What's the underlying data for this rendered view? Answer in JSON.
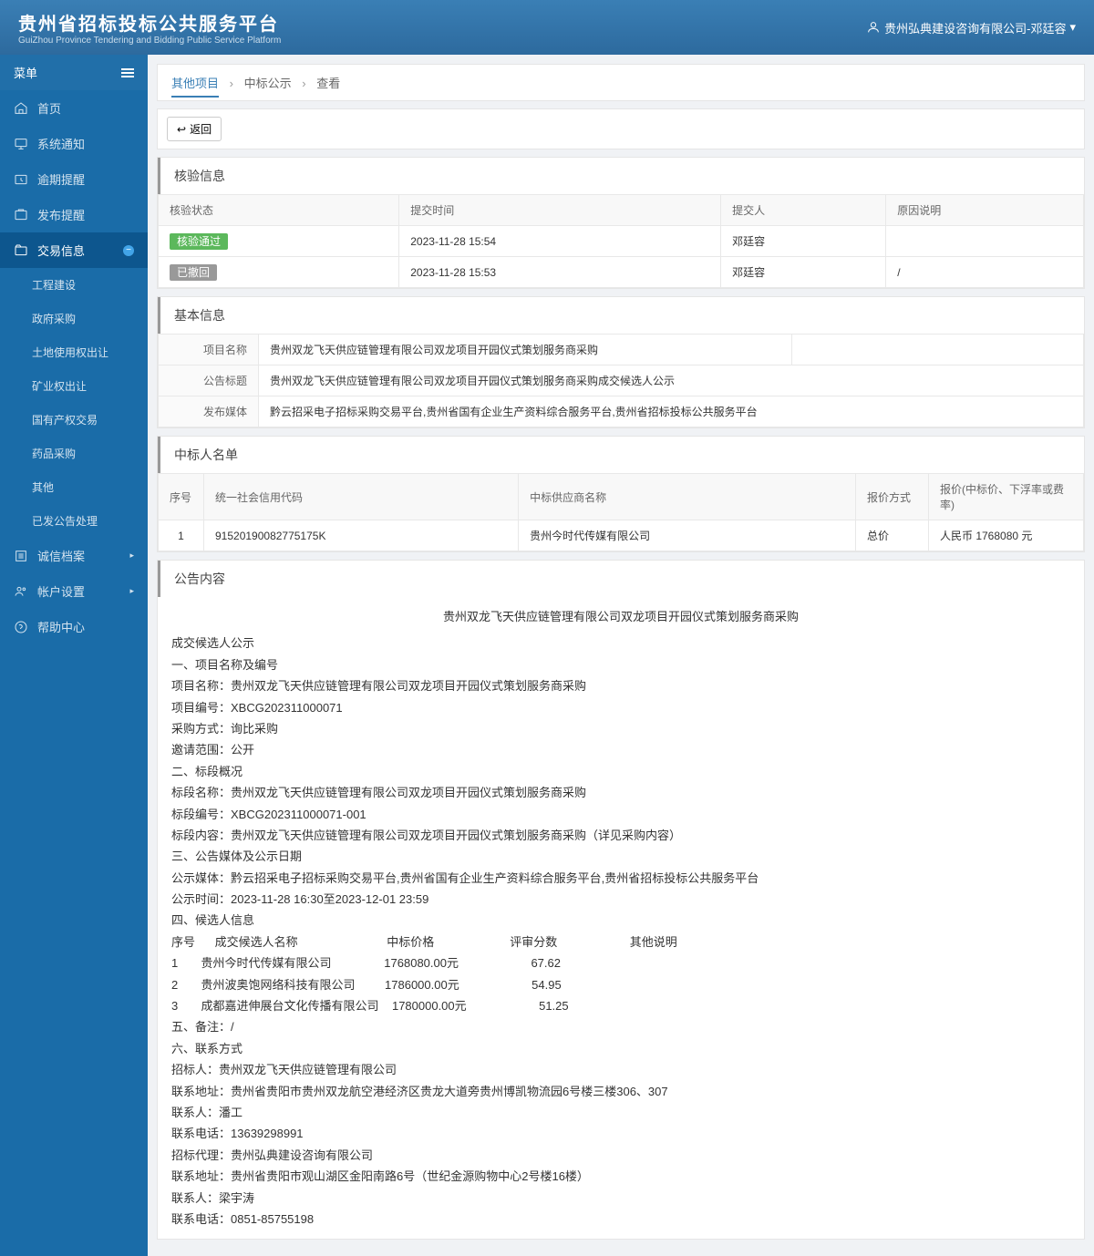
{
  "header": {
    "title": "贵州省招标投标公共服务平台",
    "subtitle": "GuiZhou Province Tendering and Bidding Public Service Platform",
    "user": "贵州弘典建设咨询有限公司-邓廷容"
  },
  "sidebar": {
    "menu_label": "菜单",
    "items": [
      {
        "label": "首页",
        "icon": "home"
      },
      {
        "label": "系统通知",
        "icon": "monitor"
      },
      {
        "label": "逾期提醒",
        "icon": "clock"
      },
      {
        "label": "发布提醒",
        "icon": "bell"
      },
      {
        "label": "交易信息",
        "icon": "folder",
        "active": true,
        "expand": true
      },
      {
        "label": "诚信档案",
        "icon": "list",
        "dot": true
      },
      {
        "label": "帐户设置",
        "icon": "user",
        "dot": true
      },
      {
        "label": "帮助中心",
        "icon": "help"
      }
    ],
    "subitems": [
      {
        "label": "工程建设"
      },
      {
        "label": "政府采购"
      },
      {
        "label": "土地使用权出让"
      },
      {
        "label": "矿业权出让"
      },
      {
        "label": "国有产权交易"
      },
      {
        "label": "药品采购"
      },
      {
        "label": "其他"
      },
      {
        "label": "已发公告处理"
      }
    ]
  },
  "breadcrumb": {
    "a": "其他项目",
    "b": "中标公示",
    "c": "查看"
  },
  "buttons": {
    "back": "返回"
  },
  "verify": {
    "title": "核验信息",
    "cols": {
      "status": "核验状态",
      "time": "提交时间",
      "person": "提交人",
      "reason": "原因说明"
    },
    "rows": [
      {
        "status": "核验通过",
        "badge": "green",
        "time": "2023-11-28 15:54",
        "person": "邓廷容",
        "reason": ""
      },
      {
        "status": "已撤回",
        "badge": "gray",
        "time": "2023-11-28 15:53",
        "person": "邓廷容",
        "reason": "/"
      }
    ]
  },
  "basic": {
    "title": "基本信息",
    "rows": {
      "project_name_label": "项目名称",
      "project_name": "贵州双龙飞天供应链管理有限公司双龙项目开园仪式策划服务商采购",
      "notice_title_label": "公告标题",
      "notice_title": "贵州双龙飞天供应链管理有限公司双龙项目开园仪式策划服务商采购成交候选人公示",
      "media_label": "发布媒体",
      "media": "黔云招采电子招标采购交易平台,贵州省国有企业生产资料综合服务平台,贵州省招标投标公共服务平台"
    }
  },
  "winners": {
    "title": "中标人名单",
    "cols": {
      "seq": "序号",
      "code": "统一社会信用代码",
      "name": "中标供应商名称",
      "method": "报价方式",
      "price": "报价(中标价、下浮率或费率)"
    },
    "rows": [
      {
        "seq": "1",
        "code": "91520190082775175K",
        "name": "贵州今时代传媒有限公司",
        "method": "总价",
        "price": "人民币 1768080 元"
      }
    ]
  },
  "announce": {
    "title": "公告内容",
    "heading": "贵州双龙飞天供应链管理有限公司双龙项目开园仪式策划服务商采购",
    "lines": [
      "成交候选人公示",
      "一、项目名称及编号",
      "项目名称：贵州双龙飞天供应链管理有限公司双龙项目开园仪式策划服务商采购",
      "项目编号：XBCG202311000071",
      "采购方式：询比采购",
      "邀请范围：公开",
      "二、标段概况",
      "标段名称：贵州双龙飞天供应链管理有限公司双龙项目开园仪式策划服务商采购",
      "标段编号：XBCG202311000071-001",
      "标段内容：贵州双龙飞天供应链管理有限公司双龙项目开园仪式策划服务商采购（详见采购内容）",
      "三、公告媒体及公示日期",
      "公示媒体：黔云招采电子招标采购交易平台,贵州省国有企业生产资料综合服务平台,贵州省招标投标公共服务平台",
      "公示时间：2023-11-28 16:30至2023-12-01 23:59",
      "四、候选人信息"
    ],
    "table_header": "序号      成交候选人名称                           中标价格                       评审分数                      其他说明",
    "table_rows": [
      "1       贵州今时代传媒有限公司                1768080.00元                      67.62",
      "2       贵州波奥饱网络科技有限公司         1786000.00元                      54.95",
      "3       成都嘉进伸展台文化传播有限公司    1780000.00元                      51.25"
    ],
    "lines2": [
      "五、备注：/",
      "六、联系方式",
      "招标人：贵州双龙飞天供应链管理有限公司",
      "联系地址：贵州省贵阳市贵州双龙航空港经济区贵龙大道旁贵州博凯物流园6号楼三楼306、307",
      "联系人：潘工",
      "联系电话：13639298991",
      "招标代理：贵州弘典建设咨询有限公司",
      "联系地址：贵州省贵阳市观山湖区金阳南路6号（世纪金源购物中心2号楼16楼）",
      "联系人：梁宇涛",
      "联系电话：0851-85755198"
    ]
  }
}
